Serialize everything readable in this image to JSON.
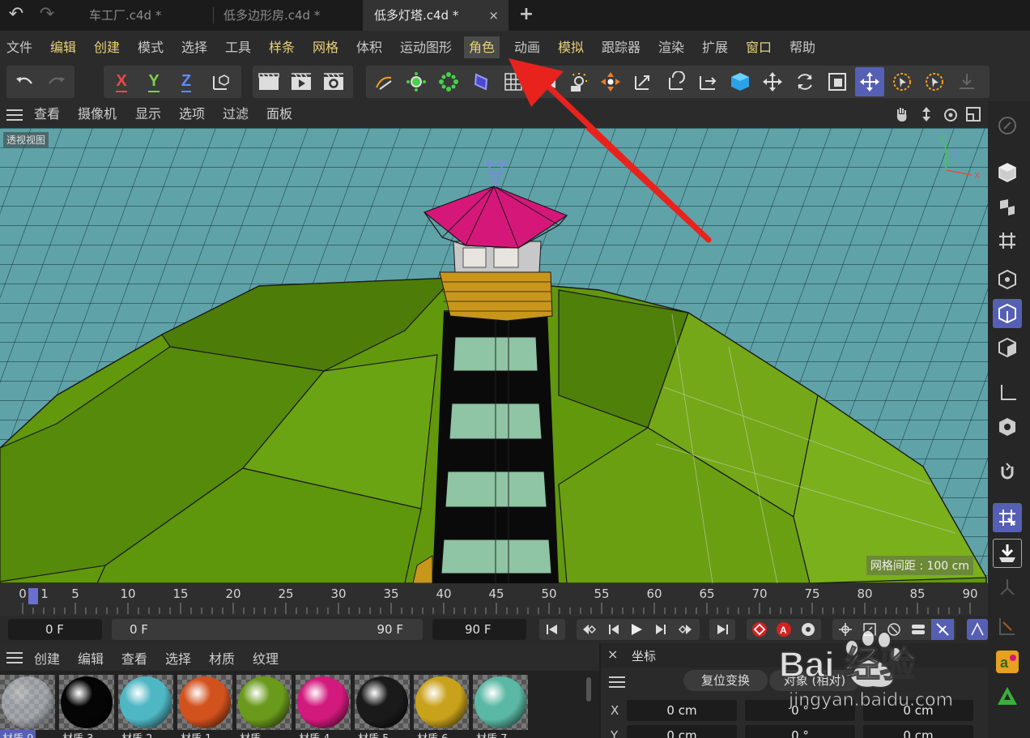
{
  "tabs": [
    {
      "label": "车工厂.c4d *",
      "active": false
    },
    {
      "label": "低多边形房.c4d *",
      "active": false
    },
    {
      "label": "低多灯塔.c4d *",
      "active": true
    }
  ],
  "tab_add": "+",
  "tab_close": "×",
  "menu": [
    {
      "label": "文件"
    },
    {
      "label": "编辑"
    },
    {
      "label": "创建"
    },
    {
      "label": "模式"
    },
    {
      "label": "选择"
    },
    {
      "label": "工具"
    },
    {
      "label": "样条"
    },
    {
      "label": "网格"
    },
    {
      "label": "体积"
    },
    {
      "label": "运动图形"
    },
    {
      "label": "角色"
    },
    {
      "label": "动画"
    },
    {
      "label": "模拟"
    },
    {
      "label": "跟踪器"
    },
    {
      "label": "渲染"
    },
    {
      "label": "扩展"
    },
    {
      "label": "窗口"
    },
    {
      "label": "帮助"
    }
  ],
  "toolbar": {
    "axis_x": "X",
    "axis_y": "Y",
    "axis_z": "Z"
  },
  "viewport_menu": [
    "查看",
    "摄像机",
    "显示",
    "选项",
    "过滤",
    "面板"
  ],
  "viewport": {
    "name": "透视视图",
    "grid_spacing": "网格间距 : 100 cm"
  },
  "timeline": {
    "ticks": [
      "0",
      "5",
      "10",
      "15",
      "20",
      "25",
      "30",
      "35",
      "40",
      "45",
      "50",
      "55",
      "60",
      "65",
      "70",
      "75",
      "80",
      "85",
      "90"
    ],
    "current_marker": "1",
    "current_frame": "0 F",
    "range_start": "0 F",
    "range_end": "90 F",
    "end_frame": "90 F"
  },
  "material_menu": [
    "创建",
    "编辑",
    "查看",
    "选择",
    "材质",
    "纹理"
  ],
  "materials": [
    {
      "name": "材质.9",
      "color": "#c8d0d8",
      "selected": true
    },
    {
      "name": "材质.3",
      "color": "#050505"
    },
    {
      "name": "材质.2",
      "color": "#4fb6c4"
    },
    {
      "name": "材质.1",
      "color": "#d2521e"
    },
    {
      "name": "材质",
      "color": "#6a9a1c"
    },
    {
      "name": "材质.4",
      "color": "#d2197c"
    },
    {
      "name": "材质.5",
      "color": "#1a1a1a"
    },
    {
      "name": "材质.6",
      "color": "#c9a21c"
    },
    {
      "name": "材质.7",
      "color": "#5ab8a4"
    }
  ],
  "coordinates": {
    "title": "坐标",
    "reset_button": "复位变换",
    "mode_button": "对象 (相对)",
    "rows": [
      {
        "label": "X",
        "pos": "0 cm",
        "rot": "0 °",
        "scale": "0 cm"
      },
      {
        "label": "Y",
        "pos": "0 cm",
        "rot": "0 °",
        "scale": "0 cm"
      }
    ]
  },
  "watermark": {
    "text": "Bai 经验",
    "url": "jingyan.baidu.com"
  },
  "colors": {
    "accent": "#5560b4",
    "menu_highlight": "#e8d27a",
    "arrow": "#e8231e",
    "ground": "#5fa3a9",
    "island": "#5a8d0c"
  }
}
